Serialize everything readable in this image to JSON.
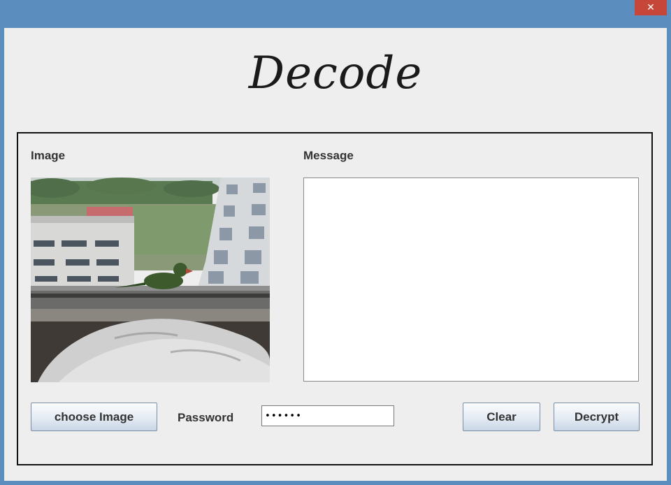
{
  "window": {
    "close_glyph": "✕"
  },
  "header": {
    "title": "Decode"
  },
  "form": {
    "image_label": "Image",
    "message_label": "Message",
    "message_value": "",
    "password_label": "Password",
    "password_value": "••••••",
    "choose_image_button": "choose Image",
    "clear_button": "Clear",
    "decrypt_button": "Decrypt"
  },
  "colors": {
    "titlebar": "#5b8dbf",
    "close_button": "#c7463a",
    "window_background": "#eeeeee"
  }
}
